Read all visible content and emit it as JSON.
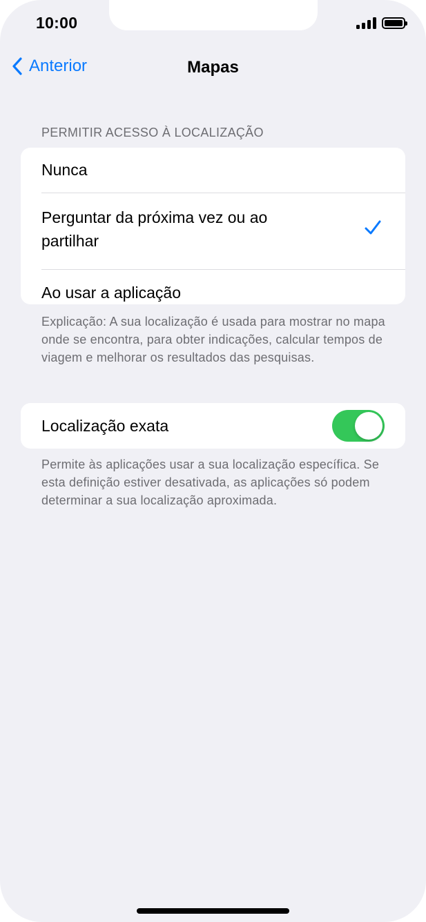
{
  "status_bar": {
    "time": "10:00",
    "signal_icon": "cellular-signal-icon",
    "battery_icon": "battery-full-icon"
  },
  "nav": {
    "back_label": "Anterior",
    "back_icon": "chevron-left-icon",
    "title": "Mapas"
  },
  "location_access": {
    "header": "PERMITIR ACESSO À LOCALIZAÇÃO",
    "options": [
      {
        "label": "Nunca",
        "selected": false
      },
      {
        "label": "Perguntar da próxima vez ou ao partilhar",
        "selected": true
      },
      {
        "label": "Ao usar a aplicação",
        "selected": false
      }
    ],
    "footer": "Explicação: A sua localização é usada para mostrar no mapa onde se encontra, para obter indicações, calcular tempos de viagem e melhorar os resultados das pesquisas."
  },
  "precise_location": {
    "label": "Localização exata",
    "enabled": true,
    "footer": "Permite às aplicações usar a sua localização específica. Se esta definição estiver desativada, as aplicações só podem determinar a sua localização aproximada."
  },
  "colors": {
    "accent": "#0a7aff",
    "toggle_on": "#34c759",
    "background": "#f0f0f5",
    "secondary_text": "#6d6d72"
  }
}
